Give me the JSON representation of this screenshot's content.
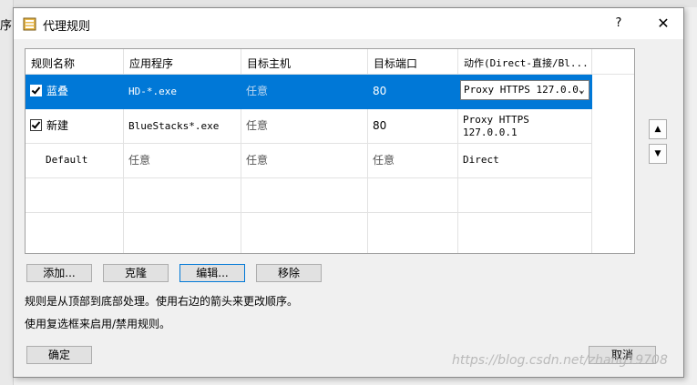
{
  "background": {
    "partial_char": "序"
  },
  "dialog": {
    "title": "代理规则",
    "help": "?",
    "close": "✕"
  },
  "table": {
    "headers": [
      "规则名称",
      "应用程序",
      "目标主机",
      "目标端口",
      "动作(Direct-直接/Bl..."
    ],
    "rows": [
      {
        "name": "蓝叠",
        "app": "HD-*.exe",
        "host": "任意",
        "port": "80",
        "action": "Proxy HTTPS 127.0.0.",
        "checked": true,
        "selected": true
      },
      {
        "name": "新建",
        "app": "BlueStacks*.exe",
        "host": "任意",
        "port": "80",
        "action_line1": "Proxy HTTPS",
        "action_line2": "127.0.0.1",
        "checked": true
      },
      {
        "name": "Default",
        "app": "任意",
        "host": "任意",
        "port": "任意",
        "action": "Direct"
      }
    ]
  },
  "buttons": {
    "add": "添加...",
    "clone": "克隆",
    "edit": "编辑...",
    "remove": "移除",
    "ok": "确定",
    "cancel": "取消"
  },
  "info": {
    "line1": "规则是从顶部到底部处理。使用右边的箭头来更改顺序。",
    "line2": "使用复选框来启用/禁用规则。"
  },
  "watermark": "https://blog.csdn.net/zhang19708",
  "colors": {
    "selection": "#0078d7",
    "focus_border": "#0078d7"
  },
  "icons": {
    "title": "rules-icon",
    "up": "arrow-up-icon",
    "down": "arrow-down-icon",
    "dropdown": "chevron-down-icon"
  }
}
